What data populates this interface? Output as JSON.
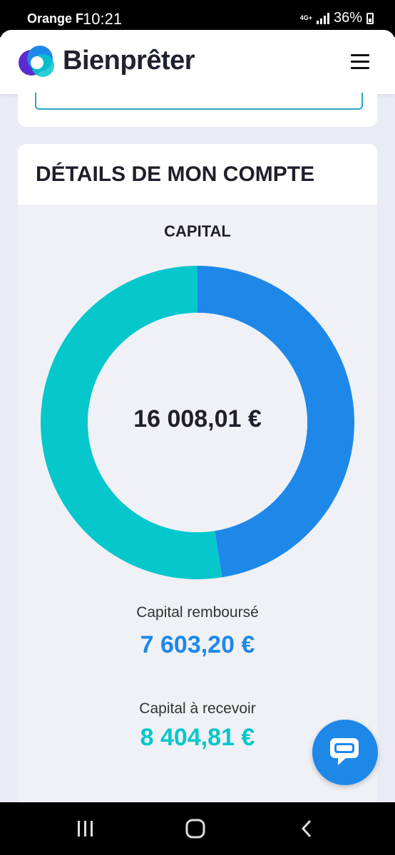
{
  "status_bar": {
    "carrier": "Orange F",
    "time": "10:21",
    "network": "4G+",
    "battery": "36%"
  },
  "header": {
    "brand": "Bienprêter"
  },
  "account": {
    "title": "DÉTAILS DE MON COMPTE",
    "capital_heading": "CAPITAL",
    "total": "16 008,01 €",
    "repaid_label": "Capital remboursé",
    "repaid_value": "7 603,20 €",
    "to_receive_label": "Capital à recevoir",
    "to_receive_value": "8 404,81 €"
  },
  "colors": {
    "repaid": "#1e88e9",
    "to_receive": "#06c7cb"
  },
  "chart_data": {
    "type": "pie",
    "categories": [
      "Capital remboursé",
      "Capital à recevoir"
    ],
    "values": [
      7603.2,
      8404.81
    ],
    "colors": [
      "#1e88e9",
      "#06c7cb"
    ]
  }
}
